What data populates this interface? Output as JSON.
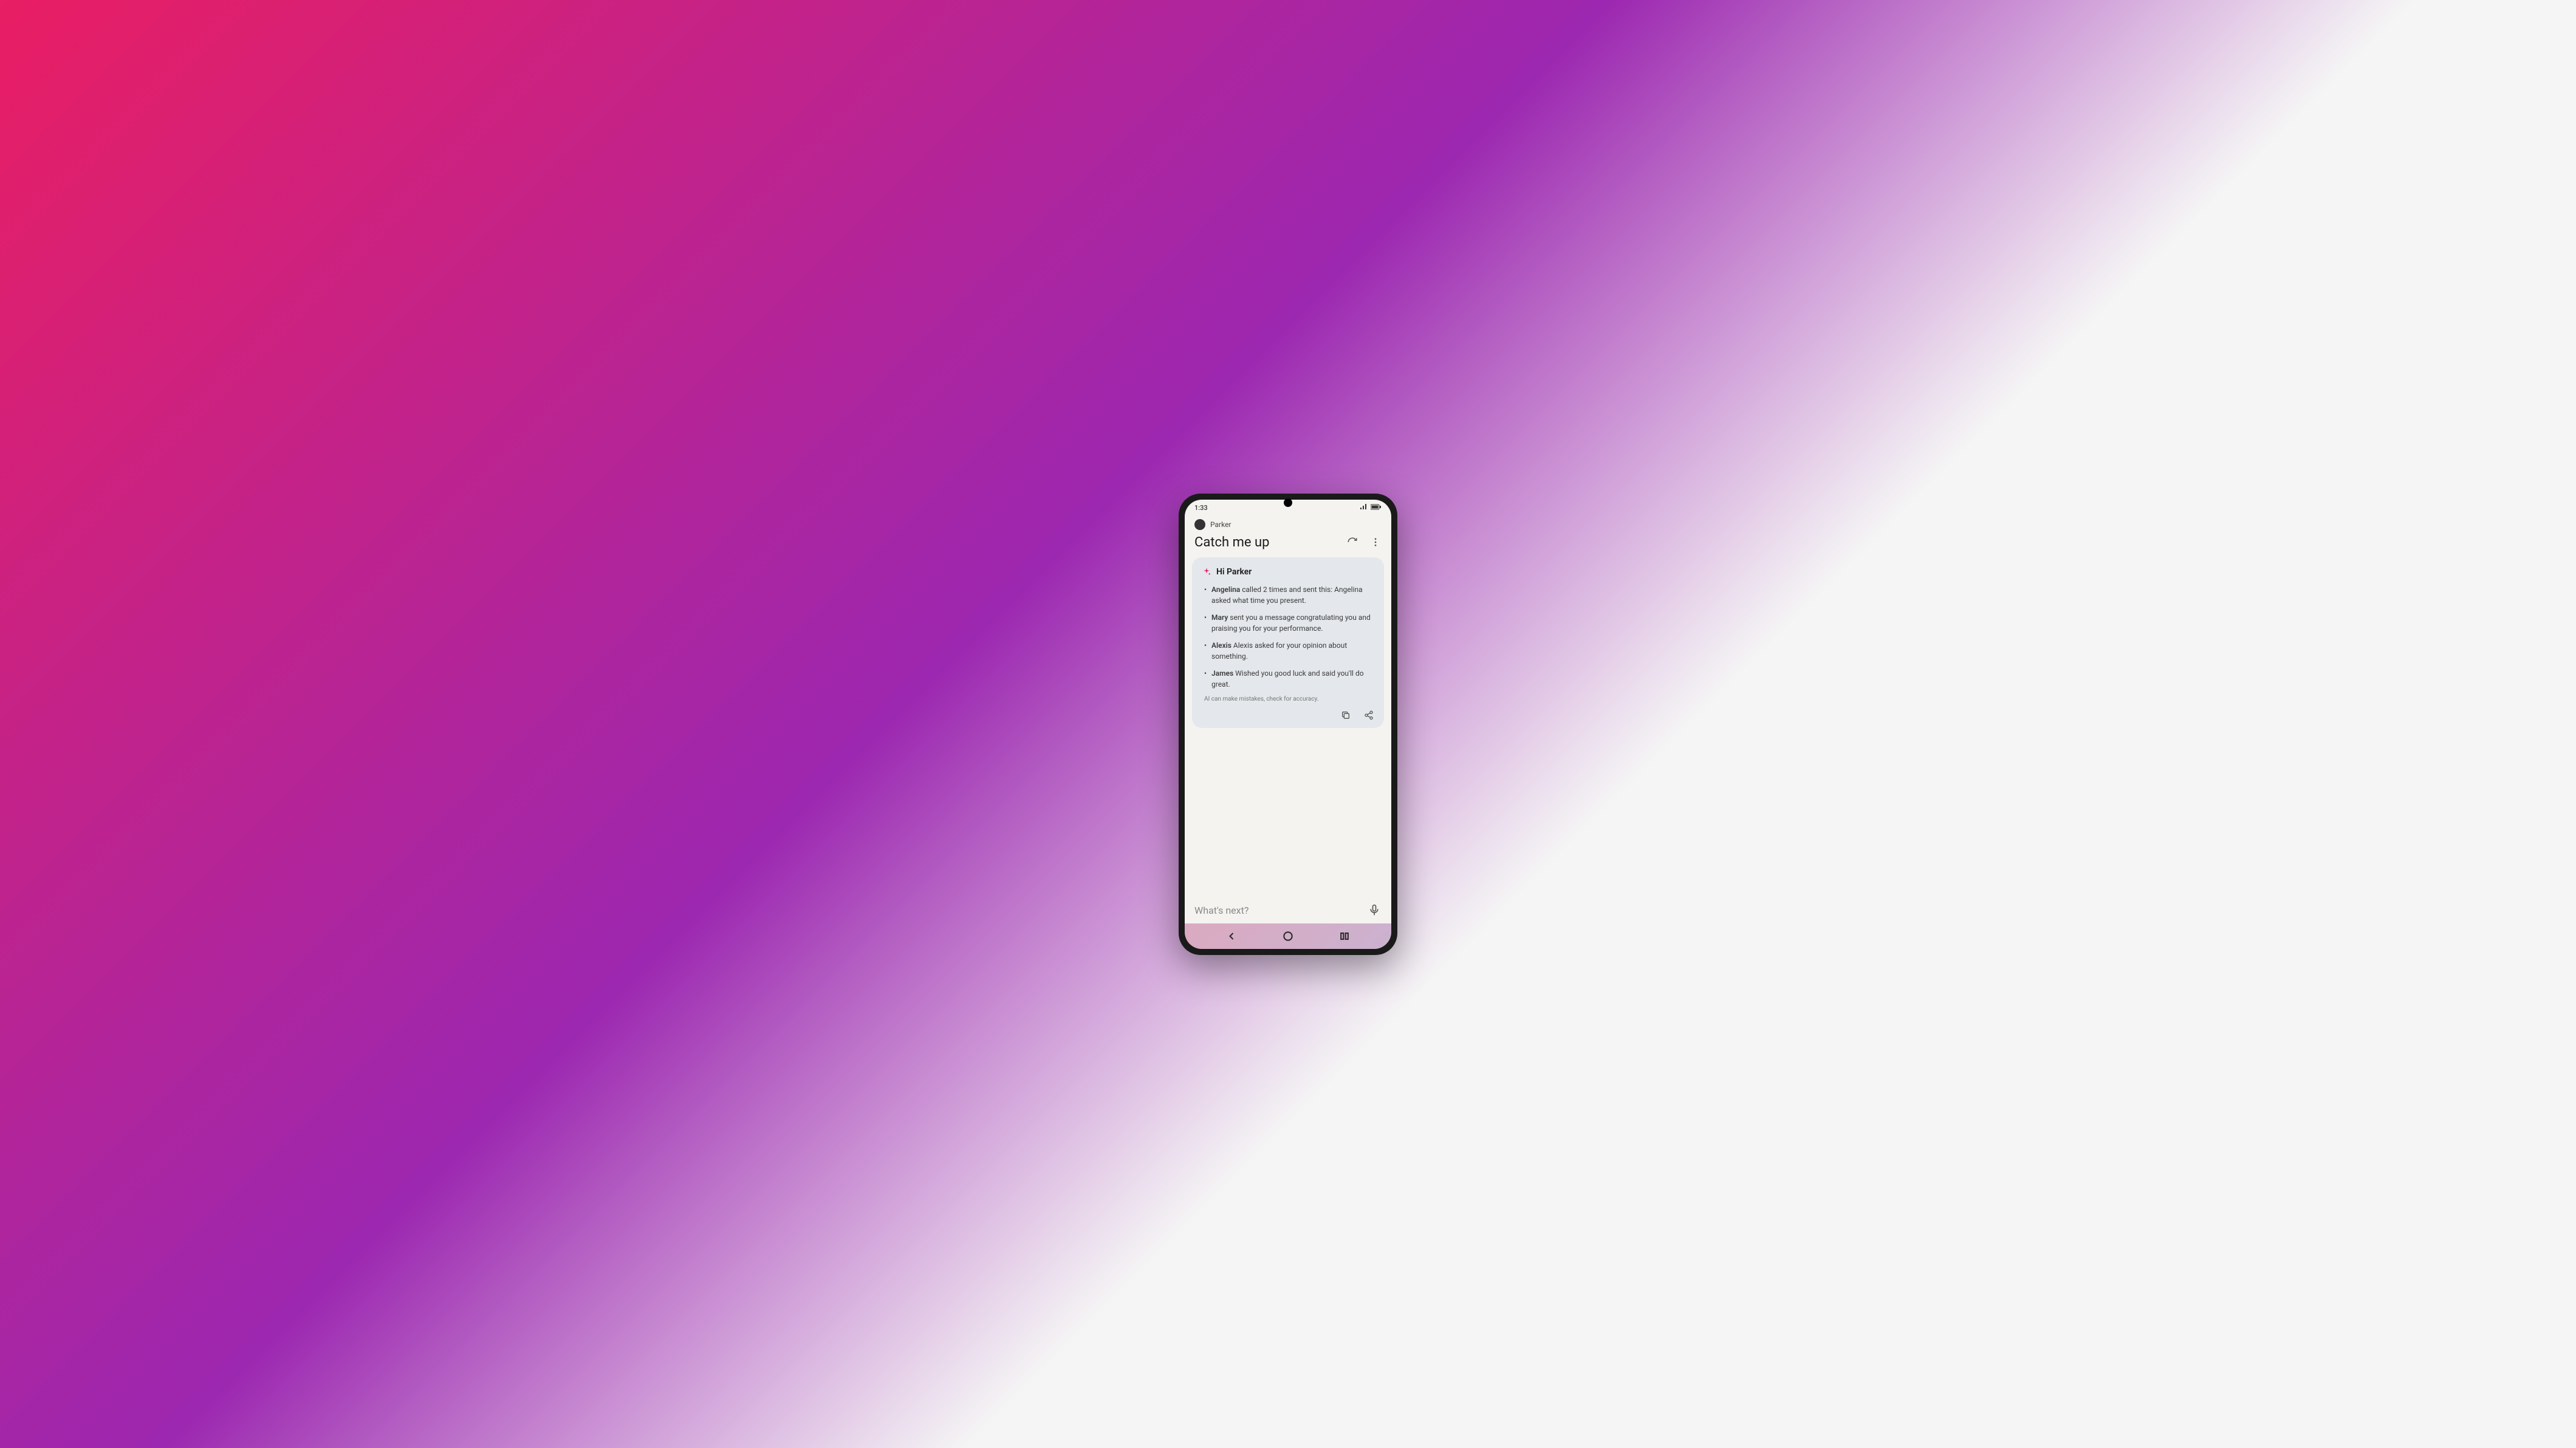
{
  "status": {
    "time": "1:33"
  },
  "header": {
    "user": "Parker",
    "title": "Catch me up"
  },
  "card": {
    "greeting": "Hi Parker",
    "items": [
      {
        "name": "Angelina",
        "text": " called 2 times and sent this: Angelina asked what time you present."
      },
      {
        "name": "Mary",
        "text": " sent you a message congratulating you and praising you for your performance."
      },
      {
        "name": "Alexis",
        "text": " Alexis asked for your opinion about something."
      },
      {
        "name": "James",
        "text": " Wished you good luck and said you'll do great."
      }
    ],
    "disclaimer": "AI can make mistakes, check for accuracy."
  },
  "input": {
    "placeholder": "What's next?"
  }
}
